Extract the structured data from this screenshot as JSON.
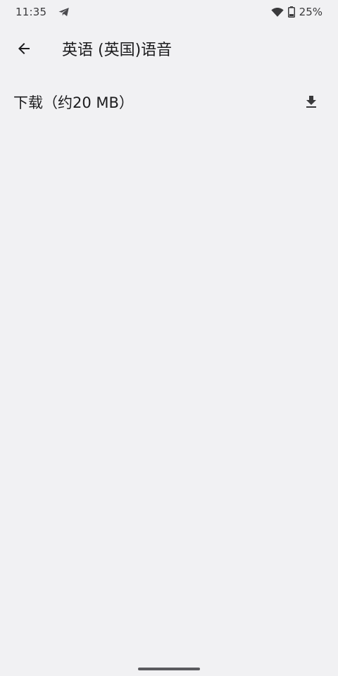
{
  "status_bar": {
    "time": "11:35",
    "battery_percent": "25%",
    "icons": [
      "telegram-icon",
      "wifi-icon",
      "battery-icon"
    ]
  },
  "app_bar": {
    "title": "英语 (英国)语音",
    "back_icon": "arrow-left-icon"
  },
  "download_item": {
    "label": "下载（约20 MB）",
    "icon": "download-icon"
  },
  "colors": {
    "background": "#f1f1f3",
    "text": "#1c1c1e",
    "icon": "#3a3a3c"
  }
}
